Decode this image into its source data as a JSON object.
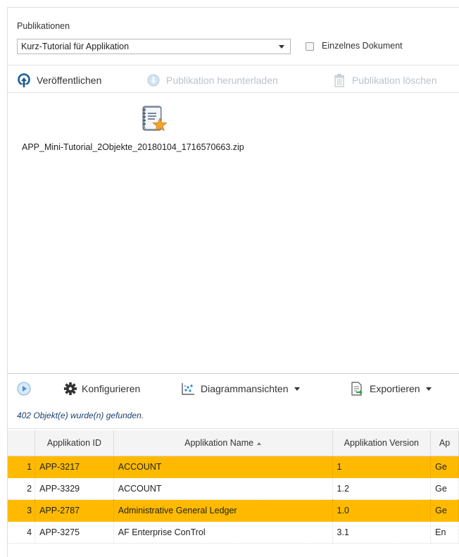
{
  "publications": {
    "label": "Publikationen",
    "selected": "Kurz-Tutorial für Applikation",
    "single_document_label": "Einzelnes Dokument"
  },
  "toolbar": {
    "publish": "Veröffentlichen",
    "download": "Publikation herunterladen",
    "delete": "Publikation löschen"
  },
  "files": [
    {
      "name": "APP_Mini-Tutorial_2Objekte_20180104_1716570663.zip",
      "icon": "zip-archive-icon"
    }
  ],
  "grid_toolbar": {
    "configure": "Konfigurieren",
    "diagram_views": "Diagrammansichten",
    "export": "Exportieren"
  },
  "result_count": "402 Objekt(e) wurde(n) gefunden.",
  "table": {
    "columns": [
      "",
      "Applikation ID",
      "Applikation Name",
      "Applikation Version",
      "Ap"
    ],
    "rows": [
      {
        "num": "1",
        "id": "APP-3217",
        "name": "ACCOUNT",
        "version": "1",
        "extra": "Ge",
        "highlighted": true
      },
      {
        "num": "2",
        "id": "APP-3329",
        "name": "ACCOUNT",
        "version": "1.2",
        "extra": "Ge",
        "highlighted": false
      },
      {
        "num": "3",
        "id": "APP-2787",
        "name": "Administrative General Ledger",
        "version": "1.0",
        "extra": "Ge",
        "highlighted": true
      },
      {
        "num": "4",
        "id": "APP-3275",
        "name": "AF Enterprise ConTrol",
        "version": "3.1",
        "extra": "En",
        "highlighted": false
      }
    ]
  },
  "colors": {
    "highlight": "#ffba00",
    "accent": "#1a3f6e",
    "disabled": "#b9c3cb"
  }
}
